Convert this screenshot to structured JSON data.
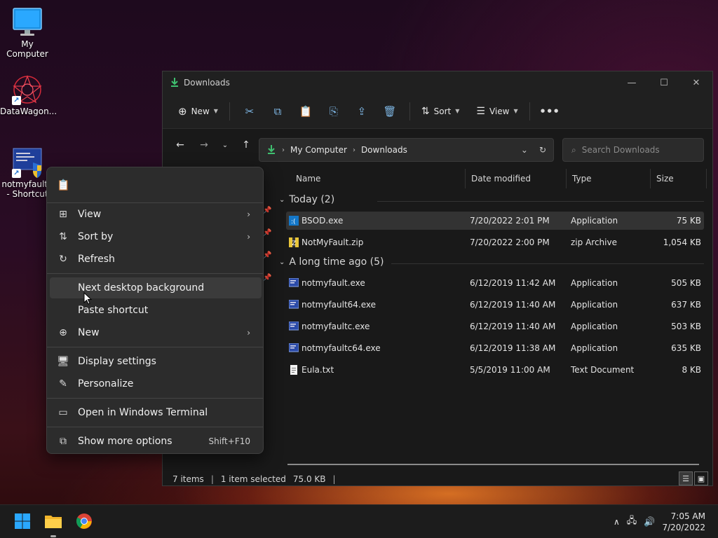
{
  "desktop": {
    "icons": [
      {
        "label": "My Computer"
      },
      {
        "label": "DataWagon..."
      },
      {
        "label": "notmyfault6 - Shortcut"
      }
    ]
  },
  "explorer": {
    "title": "Downloads",
    "toolbar": {
      "new_label": "New",
      "sort_label": "Sort",
      "view_label": "View"
    },
    "breadcrumbs": [
      "My Computer",
      "Downloads"
    ],
    "search_placeholder": "Search Downloads",
    "columns": [
      "Name",
      "Date modified",
      "Type",
      "Size"
    ],
    "groups": [
      {
        "label": "Today (2)",
        "files": [
          {
            "name": "BSOD.exe",
            "date": "7/20/2022 2:01 PM",
            "type": "Application",
            "size": "75 KB",
            "icon": "bsod-exe-icon",
            "selected": true
          },
          {
            "name": "NotMyFault.zip",
            "date": "7/20/2022 2:00 PM",
            "type": "zip Archive",
            "size": "1,054 KB",
            "icon": "zip-archive-icon",
            "selected": false
          }
        ]
      },
      {
        "label": "A long time ago (5)",
        "files": [
          {
            "name": "notmyfault.exe",
            "date": "6/12/2019 11:42 AM",
            "type": "Application",
            "size": "505 KB",
            "icon": "application-icon",
            "selected": false
          },
          {
            "name": "notmyfault64.exe",
            "date": "6/12/2019 11:40 AM",
            "type": "Application",
            "size": "637 KB",
            "icon": "application-icon",
            "selected": false
          },
          {
            "name": "notmyfaultc.exe",
            "date": "6/12/2019 11:40 AM",
            "type": "Application",
            "size": "503 KB",
            "icon": "application-icon",
            "selected": false
          },
          {
            "name": "notmyfaultc64.exe",
            "date": "6/12/2019 11:38 AM",
            "type": "Application",
            "size": "635 KB",
            "icon": "application-icon",
            "selected": false
          },
          {
            "name": "Eula.txt",
            "date": "5/5/2019 11:00 AM",
            "type": "Text Document",
            "size": "8 KB",
            "icon": "text-document-icon",
            "selected": false
          }
        ]
      }
    ],
    "status": {
      "items": "7 items",
      "selected": "1 item selected",
      "size": "75.0 KB"
    }
  },
  "context_menu": {
    "items": [
      {
        "label": "View",
        "submenu": true
      },
      {
        "label": "Sort by",
        "submenu": true
      },
      {
        "label": "Refresh"
      },
      {
        "label": "Next desktop background"
      },
      {
        "label": "Paste shortcut"
      },
      {
        "label": "New",
        "submenu": true
      },
      {
        "label": "Display settings"
      },
      {
        "label": "Personalize"
      },
      {
        "label": "Open in Windows Terminal"
      },
      {
        "label": "Show more options",
        "shortcut": "Shift+F10"
      }
    ]
  },
  "taskbar": {
    "time": "7:05 AM",
    "date": "7/20/2022"
  },
  "colors": {
    "accent": "#4cc2ff",
    "download_green": "#3fbf6f",
    "window_bg": "#191919",
    "menu_bg": "#2c2c2c"
  }
}
